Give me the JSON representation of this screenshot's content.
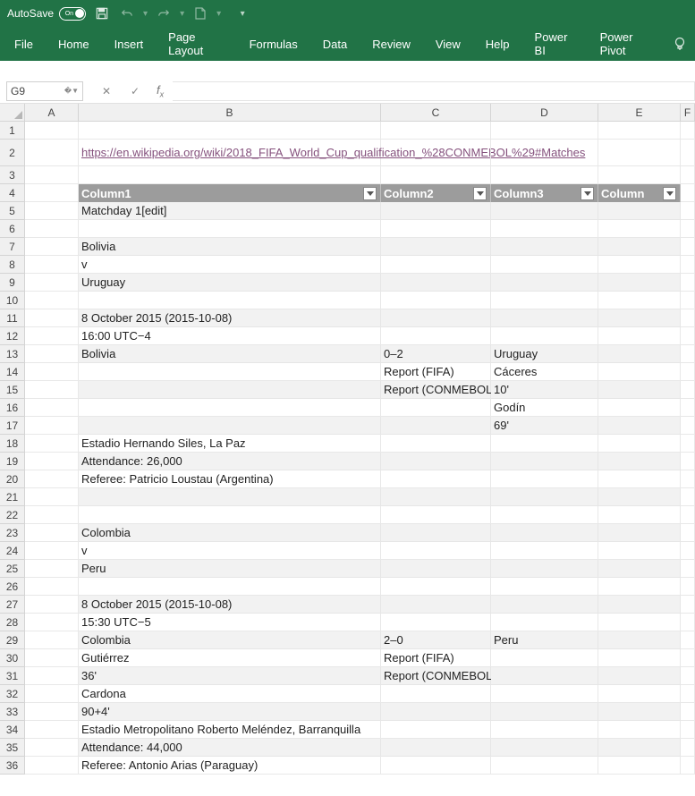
{
  "titlebar": {
    "autosave_label": "AutoSave",
    "autosave_state": "On"
  },
  "ribbon": {
    "tabs": [
      "File",
      "Home",
      "Insert",
      "Page Layout",
      "Formulas",
      "Data",
      "Review",
      "View",
      "Help",
      "Power BI",
      "Power Pivot"
    ]
  },
  "namebox": "G9",
  "columns": [
    "A",
    "B",
    "C",
    "D",
    "E",
    "F"
  ],
  "link": "https://en.wikipedia.org/wiki/2018_FIFA_World_Cup_qualification_%28CONMEBOL%29#Matches",
  "headers": {
    "c1": "Column1",
    "c2": "Column2",
    "c3": "Column3",
    "c4": "Column"
  },
  "rows": {
    "r5": {
      "B": "Matchday 1[edit]"
    },
    "r7": {
      "B": "Bolivia"
    },
    "r8": {
      "B": "v"
    },
    "r9": {
      "B": " Uruguay"
    },
    "r11": {
      "B": "8 October 2015 (2015-10-08)"
    },
    "r12": {
      "B": "16:00 UTC−4"
    },
    "r13": {
      "B": "Bolivia",
      "C": "0–2",
      "D": "Uruguay"
    },
    "r14": {
      "C": "Report (FIFA)",
      "D": "Cáceres"
    },
    "r15": {
      "C": "Report (CONMEBOL)",
      "D": "10'"
    },
    "r16": {
      "D": "Godín"
    },
    "r17": {
      "D": "69'"
    },
    "r18": {
      "B": "Estadio Hernando Siles, La Paz"
    },
    "r19": {
      "B": "Attendance: 26,000"
    },
    "r20": {
      "B": "Referee: Patricio Loustau (Argentina)"
    },
    "r23": {
      "B": "Colombia"
    },
    "r24": {
      "B": "v"
    },
    "r25": {
      "B": " Peru"
    },
    "r27": {
      "B": "8 October 2015 (2015-10-08)"
    },
    "r28": {
      "B": "15:30 UTC−5"
    },
    "r29": {
      "B": "Colombia",
      "C": "2–0",
      "D": "Peru"
    },
    "r30": {
      "B": "Gutiérrez",
      "C": "Report (FIFA)"
    },
    "r31": {
      "B": "36'",
      "C": "Report (CONMEBOL)"
    },
    "r32": {
      "B": "Cardona"
    },
    "r33": {
      "B": " 90+4'"
    },
    "r34": {
      "B": "Estadio Metropolitano Roberto Meléndez, Barranquilla"
    },
    "r35": {
      "B": "Attendance: 44,000"
    },
    "r36": {
      "B": "Referee: Antonio Arias (Paraguay)"
    }
  }
}
